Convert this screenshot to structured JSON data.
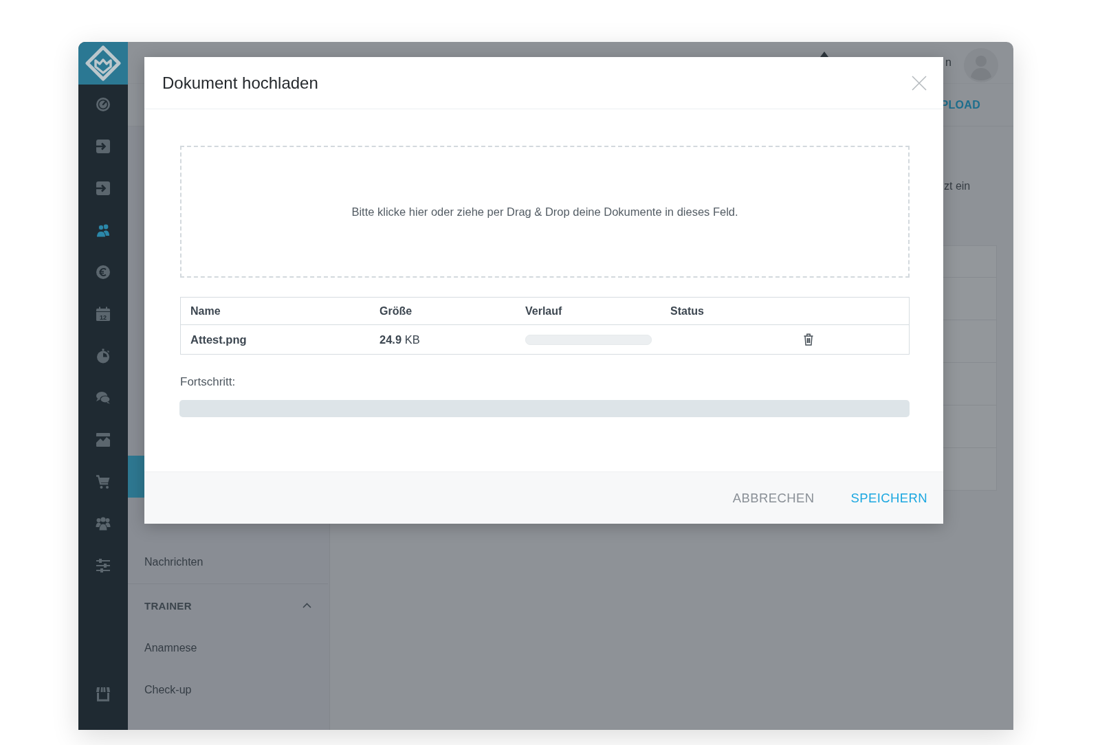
{
  "sidebar": {
    "items": [
      {
        "kind": "gauge",
        "selected": false
      },
      {
        "kind": "enter",
        "selected": false
      },
      {
        "kind": "enter",
        "selected": false
      },
      {
        "kind": "users",
        "selected": true
      },
      {
        "kind": "euro",
        "selected": false
      },
      {
        "kind": "calendar",
        "selected": false,
        "label": "12"
      },
      {
        "kind": "stopwatch",
        "selected": false
      },
      {
        "kind": "chat",
        "selected": false
      },
      {
        "kind": "chart",
        "selected": false
      },
      {
        "kind": "cart",
        "selected": false
      },
      {
        "kind": "group",
        "selected": false
      },
      {
        "kind": "sliders",
        "selected": false
      }
    ],
    "bottom_items": [
      {
        "kind": "store",
        "selected": false
      }
    ]
  },
  "header": {
    "user_name": "n"
  },
  "toolbar": {
    "link": "PLOAD"
  },
  "navigation": {
    "items": [
      {
        "selected": true
      },
      {
        "label": "Nachrichten",
        "selected": false
      }
    ],
    "sections": [
      {
        "title": "TRAINER",
        "expanded": true,
        "items": [
          {
            "label": "Anamnese",
            "selected": false
          },
          {
            "label": "Check-up",
            "selected": false
          }
        ]
      }
    ]
  },
  "content": {
    "text": "zt ein"
  },
  "dialog": {
    "title": "Dokument hochladen",
    "dropzone": {
      "text": "Bitte klicke hier oder ziehe per Drag & Drop deine Dokumente in dieses Feld."
    },
    "table": {
      "columns": [
        "Name",
        "Größe",
        "Verlauf",
        "Status"
      ],
      "rows": [
        {
          "name": "Attest.png",
          "size": "**24.9** KB"
        }
      ]
    },
    "progress": {
      "label": "Fortschritt:"
    },
    "buttons": [
      {
        "label": "ABBRECHEN",
        "kind": "secondary"
      },
      {
        "label": "SPEICHERN",
        "kind": "primary"
      }
    ]
  }
}
